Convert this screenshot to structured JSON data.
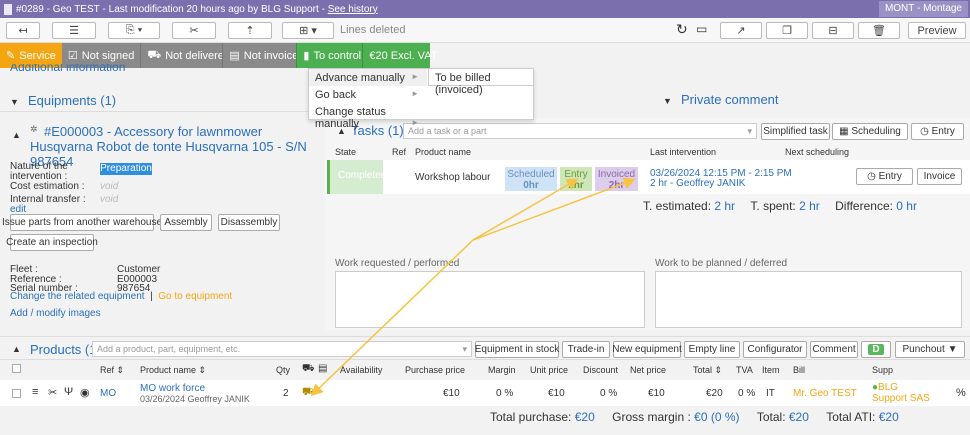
{
  "topbar": {
    "order_id": "#0289",
    "client": "Geo TEST",
    "modification": "Last modification 20 hours ago by BLG Support",
    "history_link": "See history",
    "user_badge": "MONT - Montage"
  },
  "toolbar": {
    "lines_deleted": "Lines deleted",
    "preview": "Preview"
  },
  "statusbar": {
    "service": "Service",
    "not_signed": "Not signed",
    "not_delivered": "Not delivered",
    "not_invoiced": "Not invoiced",
    "to_control": "To control",
    "amount": "€20 Excl. VAT"
  },
  "menu": {
    "items": [
      "Advance manually",
      "Go back",
      "Change status manually"
    ],
    "submenu_item": "To be billed (invoiced)"
  },
  "additional_info": "Additional information",
  "equipments": {
    "title": "Equipments (1)",
    "item_title": "#E000003 - Accessory for lawnmower Husqvarna Robot de tonte Husqvarna 105 - S/N 987654",
    "nature_label": "Nature of the intervention :",
    "nature_value": "Preparation",
    "cost_label": "Cost estimation :",
    "cost_value": "void",
    "transfer_label": "Internal transfer :",
    "transfer_value": "void",
    "edit": "edit",
    "issue_parts": "Issue parts from another warehouse",
    "assembly": "Assembly",
    "disassembly": "Disassembly",
    "create_inspection": "Create an inspection",
    "fleet_label": "Fleet :",
    "fleet_value": "Customer",
    "reference_label": "Reference :",
    "reference_value": "E000003",
    "serial_label": "Serial number :",
    "serial_value": "987654",
    "change_equipment": "Change the related equipment",
    "go_equipment": "Go to equipment",
    "add_images": "Add / modify images"
  },
  "private_comment": "Private comment",
  "tasks": {
    "title": "Tasks (1)",
    "placeholder": "Add a task or a part",
    "simplified_task": "Simplified task",
    "scheduling": "Scheduling",
    "entry": "Entry",
    "headers": {
      "state": "State",
      "ref": "Ref",
      "product": "Product name",
      "last": "Last intervention",
      "next": "Next scheduling"
    },
    "row": {
      "state": "Completed",
      "product": "Workshop labour",
      "scheduled": "Scheduled",
      "scheduled_hr": "0hr",
      "entry_tag": "Entry",
      "entry_hr": "2hr",
      "invoiced": "Invoiced",
      "invoiced_hr": "2hr",
      "last_date": "03/26/2024 12:15 PM - 2:15 PM",
      "last_who": "2 hr - Geoffrey JANIK",
      "entry_btn": "Entry",
      "invoice_btn": "Invoice"
    },
    "t_estimated_label": "T. estimated:",
    "t_estimated": "2 hr",
    "t_spent_label": "T. spent:",
    "t_spent": "2 hr",
    "difference_label": "Difference:",
    "difference": "0 hr"
  },
  "work_requested": "Work requested / performed",
  "work_planned": "Work to be planned / deferred",
  "products": {
    "title": "Products (1)",
    "placeholder": "Add a product, part, equipment, etc.",
    "buttons": [
      "Equipment in stock",
      "Trade-in",
      "New equipment",
      "Empty line",
      "Configurator",
      "Comment",
      "D",
      "Punchout"
    ],
    "headers": {
      "ref": "Ref",
      "name": "Product name",
      "qty": "Qty",
      "availability": "Availability",
      "purchase": "Purchase price",
      "margin": "Margin",
      "unit": "Unit price",
      "discount": "Discount",
      "net": "Net price",
      "total": "Total",
      "tva": "TVA",
      "item": "Item",
      "bill": "Bill",
      "supp": "Supp"
    },
    "row": {
      "ref": "MO",
      "name": "MO work force",
      "sub": "03/26/2024 Geoffrey JANIK",
      "qty": "2",
      "purchase": "€10",
      "margin": "0 %",
      "unit": "€10",
      "discount": "0 %",
      "net": "€10",
      "total": "€20",
      "tva": "0 %",
      "item": "IT",
      "bill": "Mr. Geo TEST",
      "supp": "BLG Support SAS",
      "pct": "%"
    },
    "total_purchase_label": "Total purchase:",
    "total_purchase": "€20",
    "gross_margin_label": "Gross margin :",
    "gross_margin": "€0 (0 %)",
    "total_label": "Total:",
    "total": "€20",
    "total_ati_label": "Total ATI:",
    "total_ati": "€20"
  },
  "colors": {
    "header_purple": "#7b6fae",
    "service_orange": "#f4a612",
    "status_grey": "#8a8a8a",
    "to_control_green": "#4caf50",
    "link_blue": "#2a6fbd",
    "arrow_yellow": "#f6c343"
  }
}
